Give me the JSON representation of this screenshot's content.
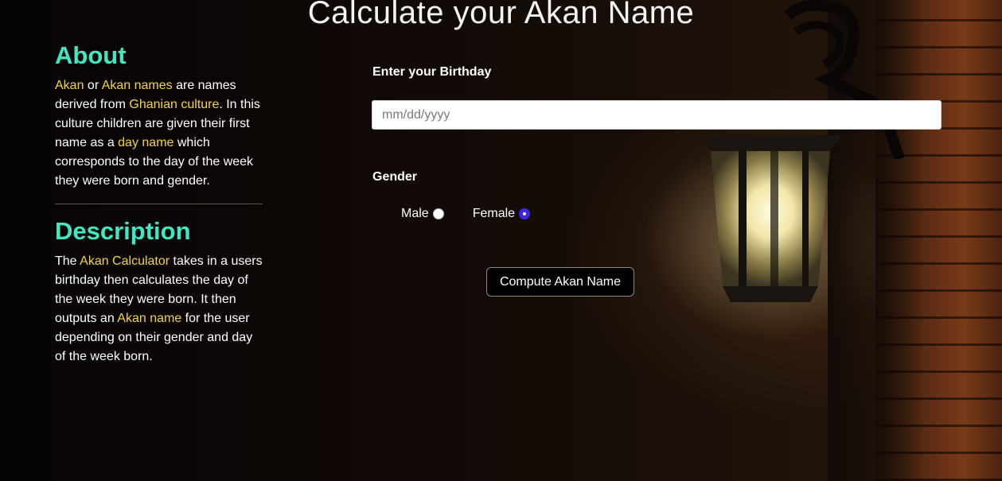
{
  "page": {
    "title": "Calculate your Akan Name"
  },
  "about": {
    "heading": "About",
    "text": [
      {
        "t": "Akan",
        "hl": true
      },
      {
        "t": " or ",
        "hl": false
      },
      {
        "t": "Akan names",
        "hl": true
      },
      {
        "t": " are names derived from ",
        "hl": false
      },
      {
        "t": "Ghanian culture",
        "hl": true
      },
      {
        "t": ". In this culture children are given their first name as a ",
        "hl": false
      },
      {
        "t": "day name",
        "hl": true
      },
      {
        "t": " which corresponds to the day of the week they were born and gender.",
        "hl": false
      }
    ]
  },
  "description": {
    "heading": "Description",
    "text": [
      {
        "t": "The ",
        "hl": false
      },
      {
        "t": "Akan Calculator",
        "hl": true
      },
      {
        "t": " takes in a users birthday then calculates the day of the week they were born. It then outputs an ",
        "hl": false
      },
      {
        "t": "Akan name",
        "hl": true
      },
      {
        "t": " for the user depending on their gender and day of the week born.",
        "hl": false
      }
    ]
  },
  "form": {
    "birthday_label": "Enter your Birthday",
    "birthday_placeholder": "mm/dd/yyyy",
    "birthday_value": "",
    "gender_label": "Gender",
    "gender_options": [
      {
        "label": "Male",
        "checked": false
      },
      {
        "label": "Female",
        "checked": true
      }
    ],
    "submit_label": "Compute Akan Name"
  },
  "colors": {
    "heading_accent": "#3fe8c4",
    "highlight": "#f3d535",
    "radio_checked": "#3d26e6"
  }
}
